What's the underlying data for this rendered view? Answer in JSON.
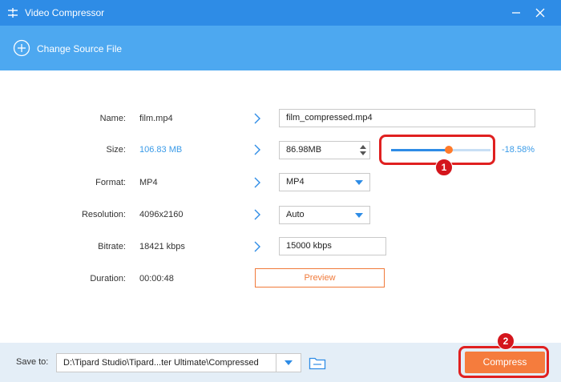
{
  "window": {
    "title": "Video Compressor",
    "app_icon": "equalizer-icon"
  },
  "toolbar": {
    "change_source_label": "Change Source File",
    "icon": "plus-circle-icon"
  },
  "form": {
    "name": {
      "label": "Name:",
      "source": "film.mp4",
      "output": "film_compressed.mp4"
    },
    "size": {
      "label": "Size:",
      "source": "106.83 MB",
      "output": "86.98MB",
      "percent": "-18.58%",
      "slider_value": 0.58
    },
    "format": {
      "label": "Format:",
      "source": "MP4",
      "output": "MP4"
    },
    "resolution": {
      "label": "Resolution:",
      "source": "4096x2160",
      "output": "Auto"
    },
    "bitrate": {
      "label": "Bitrate:",
      "source": "18421 kbps",
      "output": "15000 kbps"
    },
    "duration": {
      "label": "Duration:",
      "source": "00:00:48"
    },
    "preview_label": "Preview"
  },
  "annotations": {
    "badge1": "1",
    "badge2": "2"
  },
  "footer": {
    "save_to_label": "Save to:",
    "save_path": "D:\\Tipard Studio\\Tipard...ter Ultimate\\Compressed",
    "compress_label": "Compress"
  },
  "colors": {
    "primary": "#2e8ce6",
    "toolbar": "#4da8f0",
    "accent": "#f57c3d",
    "highlight": "#e02020"
  }
}
